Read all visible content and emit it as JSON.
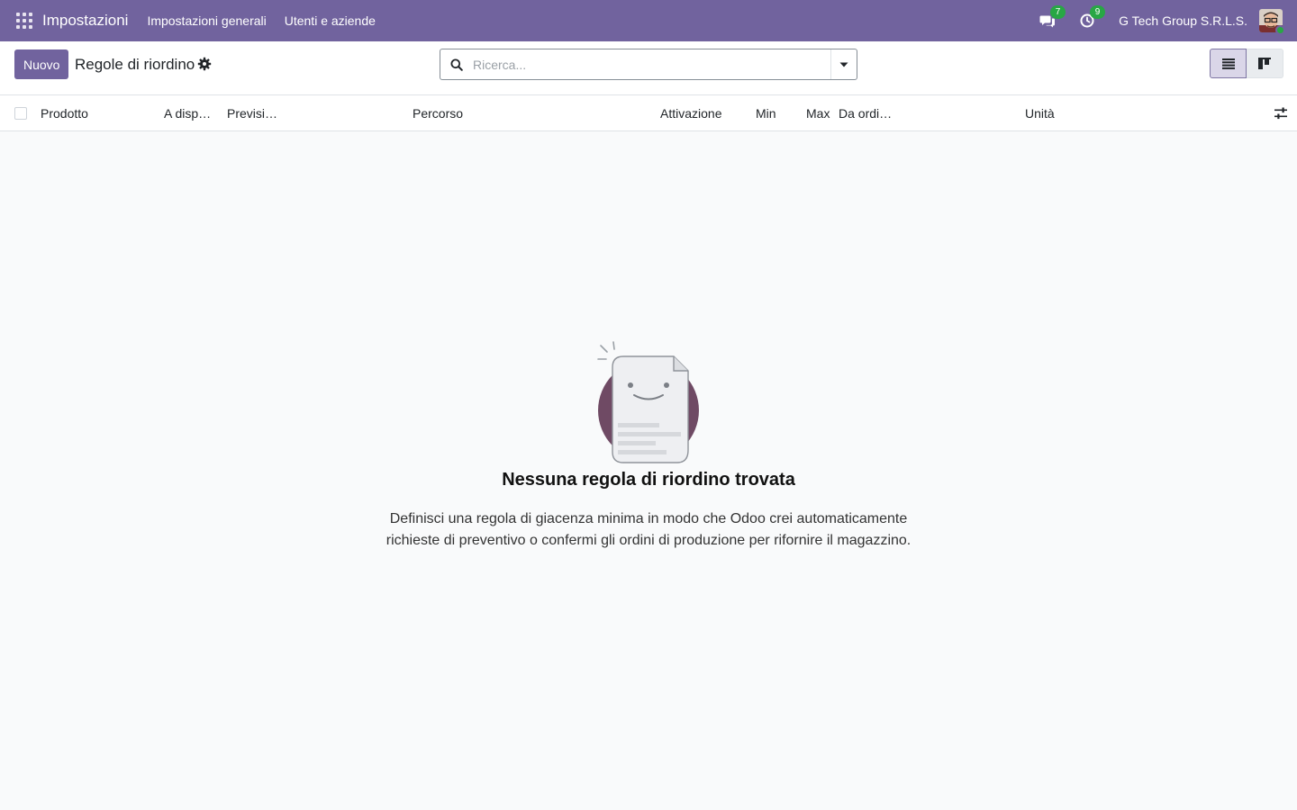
{
  "navbar": {
    "app_name": "Impostazioni",
    "menu": [
      "Impostazioni generali",
      "Utenti e aziende"
    ],
    "messages_count": "7",
    "activities_count": "9",
    "company": "G Tech Group S.R.L.S."
  },
  "control_panel": {
    "new_button": "Nuovo",
    "title": "Regole di riordino",
    "search_placeholder": "Ricerca..."
  },
  "list": {
    "columns": [
      "Prodotto",
      "A disp…",
      "Previsi…",
      "Percorso",
      "Attivazione",
      "Min",
      "Max",
      "Da ordi…",
      "Unità"
    ]
  },
  "empty_state": {
    "title": "Nessuna regola di riordino trovata",
    "line1": "Definisci una regola di giacenza minima in modo che Odoo crei automaticamente",
    "line2": "richieste di preventivo o confermi gli ordini di produzione per rifornire il magazzino."
  },
  "colors": {
    "brand": "#71639e",
    "badge": "#28a745",
    "illustration_circle": "#6f4a64"
  },
  "icons": [
    "apps-icon",
    "messages-icon",
    "activity-clock-icon",
    "avatar",
    "gear-icon",
    "search-icon",
    "caret-down-icon",
    "list-view-icon",
    "kanban-view-icon",
    "optional-columns-icon",
    "empty-document-illustration"
  ]
}
